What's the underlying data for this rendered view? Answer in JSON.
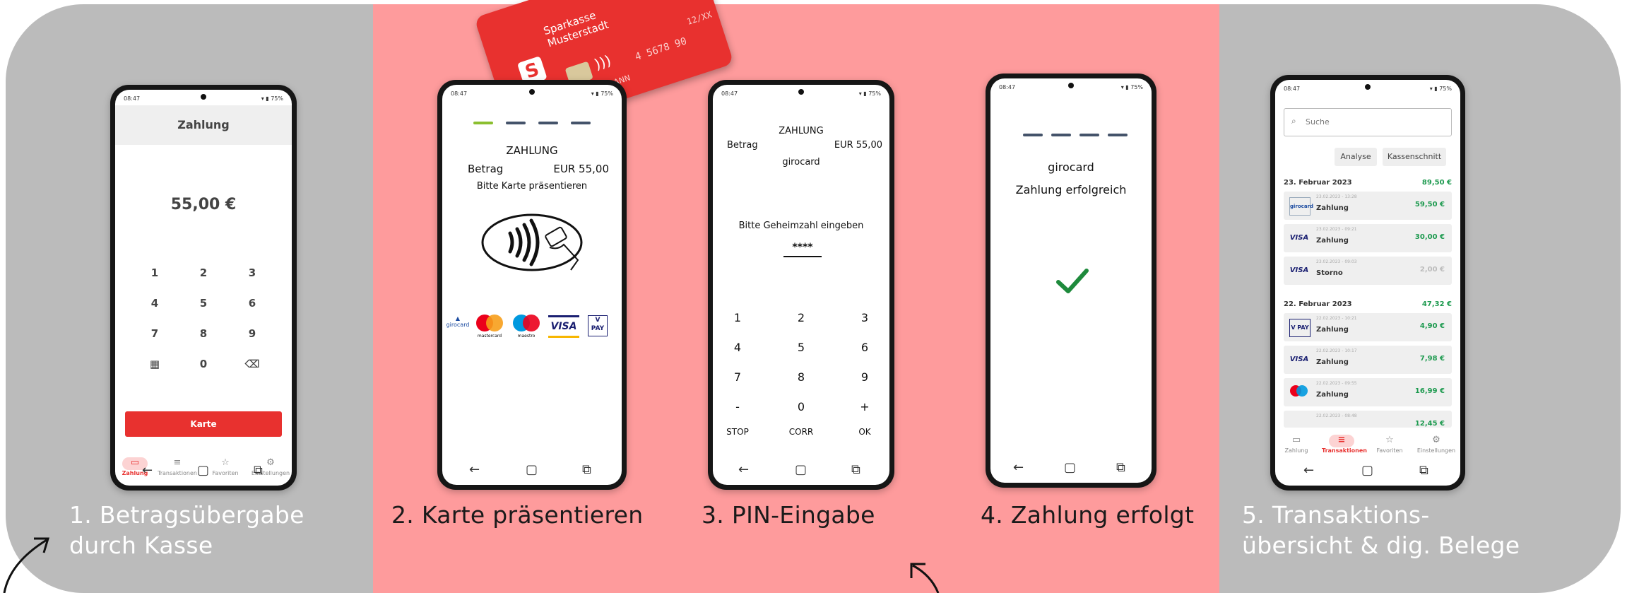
{
  "captions": {
    "step1": [
      "1. Betragsübergabe",
      "durch Kasse"
    ],
    "step2": "2. Karte präsentieren",
    "step3": "3. PIN-Eingabe",
    "step4": "4. Zahlung erfolgt",
    "step5": [
      "5. Transaktions-",
      "übersicht & dig. Belege"
    ]
  },
  "colors": {
    "side_bg": "#bbbbbb",
    "mid_bg": "#fe9b9c",
    "accent_red": "#e8312f",
    "success_green": "#1d9a4f"
  },
  "card": {
    "bank": [
      "Sparkasse",
      "Musterstadt"
    ],
    "number": "4 5678 90",
    "expiry": "12/XX",
    "name_fragment": "ANN",
    "brand": "girocard"
  },
  "status_bar": {
    "time": "08:47",
    "battery": "75%"
  },
  "phone1": {
    "title": "Zahlung",
    "amount": "55,00 €",
    "keys": [
      "1",
      "2",
      "3",
      "4",
      "5",
      "6",
      "7",
      "8",
      "9",
      "0"
    ],
    "pay_button": "Karte",
    "tabs": [
      "Zahlung",
      "Transaktionen",
      "Favoriten",
      "Einstellungen"
    ],
    "active_tab": "Zahlung"
  },
  "phone2": {
    "heading": "ZAHLUNG",
    "betrag_label": "Betrag",
    "betrag_value": "EUR 55,00",
    "instruction": "Bitte Karte präsentieren",
    "logos": [
      "girocard",
      "mastercard",
      "maestro",
      "VISA",
      "V PAY"
    ]
  },
  "phone3": {
    "heading": "ZAHLUNG",
    "betrag_label": "Betrag",
    "betrag_value": "EUR 55,00",
    "card_type": "girocard",
    "prompt": "Bitte Geheimzahl eingeben",
    "pin": "****",
    "keys": [
      "1",
      "2",
      "3",
      "4",
      "5",
      "6",
      "7",
      "8",
      "9",
      "-",
      "0",
      "+"
    ],
    "actions": [
      "STOP",
      "CORR",
      "OK"
    ]
  },
  "phone4": {
    "card_type": "girocard",
    "status": "Zahlung erfolgreich"
  },
  "phone5": {
    "search_placeholder": "Suche",
    "chips": [
      "Analyse",
      "Kassenschnitt"
    ],
    "groups": [
      {
        "date": "23. Februar 2023",
        "sum": "89,50 €",
        "rows": [
          {
            "brand": "girocard",
            "time": "23.02.2023 - 13:28",
            "label": "Zahlung",
            "amount": "59,50 €"
          },
          {
            "brand": "VISA",
            "time": "23.02.2023 - 09:21",
            "label": "Zahlung",
            "amount": "30,00 €"
          },
          {
            "brand": "VISA",
            "time": "23.02.2023 - 09:03",
            "label": "Storno",
            "amount": "2,00 €"
          }
        ]
      },
      {
        "date": "22. Februar 2023",
        "sum": "47,32 €",
        "rows": [
          {
            "brand": "V PAY",
            "time": "22.02.2023 - 10:21",
            "label": "Zahlung",
            "amount": "4,90 €"
          },
          {
            "brand": "VISA",
            "time": "22.02.2023 - 10:17",
            "label": "Zahlung",
            "amount": "7,98 €"
          },
          {
            "brand": "mastercard",
            "time": "22.02.2023 - 09:55",
            "label": "Zahlung",
            "amount": "16,99 €"
          },
          {
            "brand": "",
            "time": "22.02.2023 - 08:48",
            "label": "",
            "amount": "12,45 €"
          }
        ]
      }
    ],
    "tabs": [
      "Zahlung",
      "Transaktionen",
      "Favoriten",
      "Einstellungen"
    ],
    "active_tab": "Transaktionen"
  }
}
